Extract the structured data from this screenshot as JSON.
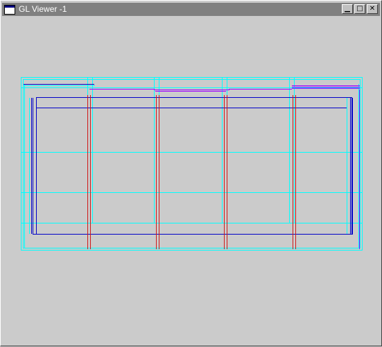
{
  "window": {
    "title": "GL Viewer -1",
    "controls": {
      "minimize": "▁",
      "maximize": "□",
      "close": "✕"
    }
  },
  "icons": {
    "app": "window-icon",
    "minimize": "minimize-icon",
    "maximize": "maximize-icon",
    "close": "close-icon"
  },
  "colors": {
    "titlebar": "#808080",
    "background": "#cbcbcb",
    "grid_cyan": "#00ffff",
    "frame_blue": "#0000c8",
    "post_red": "#d01818",
    "rail_purple": "#a000ff"
  }
}
